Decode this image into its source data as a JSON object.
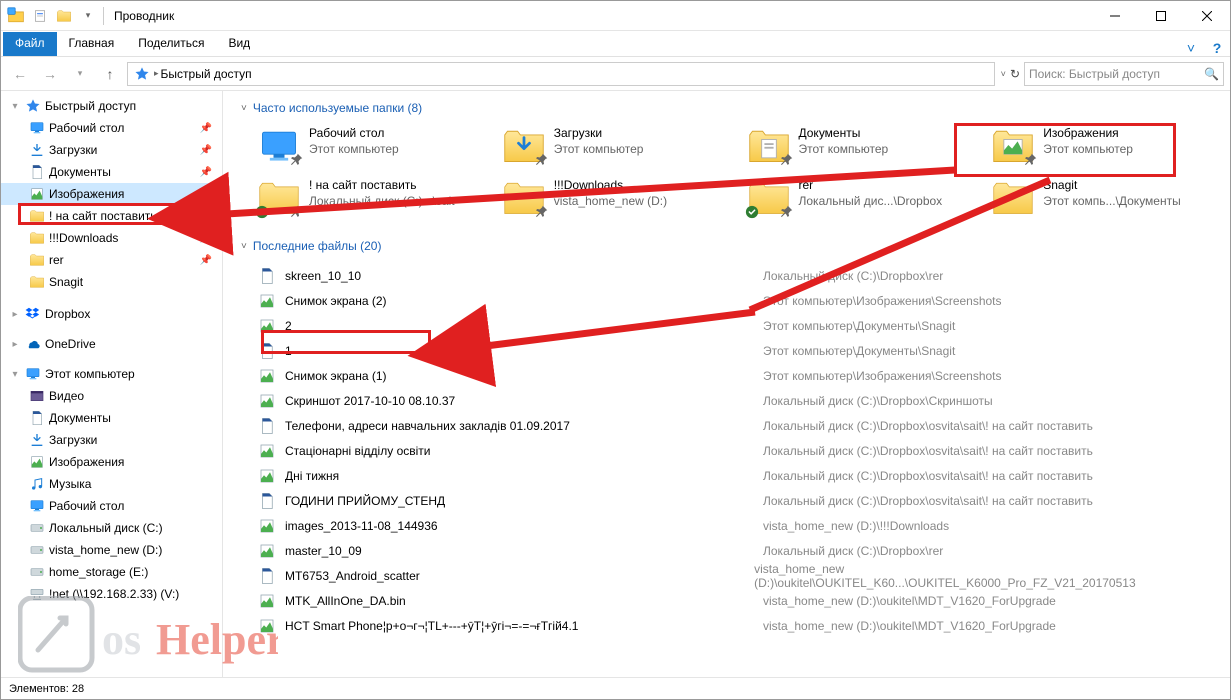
{
  "window": {
    "title": "Проводник"
  },
  "ribbon": {
    "file": "Файл",
    "home": "Главная",
    "share": "Поделиться",
    "view": "Вид"
  },
  "addr": {
    "crumb": "Быстрый доступ",
    "search_placeholder": "Поиск: Быстрый доступ"
  },
  "sidebar": {
    "quick_access": "Быстрый доступ",
    "desktop": "Рабочий стол",
    "downloads": "Загрузки",
    "documents": "Документы",
    "pictures": "Изображения",
    "site": "! на сайт поставить",
    "dldir": "!!!Downloads",
    "rer": "rer",
    "snagit": "Snagit",
    "dropbox": "Dropbox",
    "onedrive": "OneDrive",
    "this_pc": "Этот компьютер",
    "video": "Видео",
    "docs2": "Документы",
    "dl2": "Загрузки",
    "img2": "Изображения",
    "music": "Музыка",
    "desk2": "Рабочий стол",
    "cdrive": "Локальный диск (C:)",
    "vhome": "vista_home_new (D:)",
    "hstore": "home_storage (E:)",
    "netv": "!net (\\\\192.168.2.33) (V:)"
  },
  "sections": {
    "folders_title": "Часто используемые папки (8)",
    "files_title": "Последние файлы (20)"
  },
  "folders": [
    {
      "title": "Рабочий стол",
      "sub": "Этот компьютер",
      "pinned": true,
      "special": "desktop"
    },
    {
      "title": "Загрузки",
      "sub": "Этот компьютер",
      "pinned": true,
      "special": "downloads"
    },
    {
      "title": "Документы",
      "sub": "Этот компьютер",
      "pinned": true,
      "special": "documents"
    },
    {
      "title": "Изображения",
      "sub": "Этот компьютер",
      "pinned": true,
      "special": "pictures"
    },
    {
      "title": "! на сайт поставить",
      "sub": "Локальный диск (C:)...\\sait",
      "pinned": true,
      "special": "folder",
      "sync": true
    },
    {
      "title": "!!!Downloads",
      "sub": "vista_home_new (D:)",
      "pinned": true,
      "special": "folder"
    },
    {
      "title": "rer",
      "sub": "Локальный дис...\\Dropbox",
      "pinned": true,
      "special": "folder",
      "sync": true
    },
    {
      "title": "Snagit",
      "sub": "Этот компь...\\Документы",
      "pinned": false,
      "special": "folder"
    }
  ],
  "files": [
    {
      "name": "skreen_10_10",
      "path": "Локальный диск (C:)\\Dropbox\\rer"
    },
    {
      "name": "Снимок экрана (2)",
      "path": "Этот компьютер\\Изображения\\Screenshots"
    },
    {
      "name": "2",
      "path": "Этот компьютер\\Документы\\Snagit"
    },
    {
      "name": "1",
      "path": "Этот компьютер\\Документы\\Snagit"
    },
    {
      "name": "Снимок экрана (1)",
      "path": "Этот компьютер\\Изображения\\Screenshots"
    },
    {
      "name": "Скриншот 2017-10-10 08.10.37",
      "path": "Локальный диск (C:)\\Dropbox\\Скриншоты"
    },
    {
      "name": "Телефони, адреси навчальних закладів 01.09.2017",
      "path": "Локальный диск (C:)\\Dropbox\\osvita\\sait\\! на сайт поставить"
    },
    {
      "name": "Стаціонарні відділу освіти",
      "path": "Локальный диск (C:)\\Dropbox\\osvita\\sait\\! на сайт поставить"
    },
    {
      "name": "Дні тижня",
      "path": "Локальный диск (C:)\\Dropbox\\osvita\\sait\\! на сайт поставить"
    },
    {
      "name": "ГОДИНИ ПРИЙОМУ_СТЕНД",
      "path": "Локальный диск (C:)\\Dropbox\\osvita\\sait\\! на сайт поставить"
    },
    {
      "name": "images_2013-11-08_144936",
      "path": "vista_home_new (D:)\\!!!Downloads"
    },
    {
      "name": "master_10_09",
      "path": "Локальный диск (C:)\\Dropbox\\rer"
    },
    {
      "name": "MT6753_Android_scatter",
      "path": "vista_home_new (D:)\\oukitel\\OUKITEL_K60...\\OUKITEL_K6000_Pro_FZ_V21_20170513"
    },
    {
      "name": "MTK_AllInOne_DA.bin",
      "path": "vista_home_new (D:)\\oukitel\\MDT_V1620_ForUpgrade"
    },
    {
      "name": "HCT Smart Phone¦p+о¬г¬¦TL+---+ӯT¦+ӯгі¬=-=¬ғTгій4.1",
      "path": "vista_home_new (D:)\\oukitel\\MDT_V1620_ForUpgrade"
    }
  ],
  "status": {
    "elements": "Элементов: 28"
  }
}
